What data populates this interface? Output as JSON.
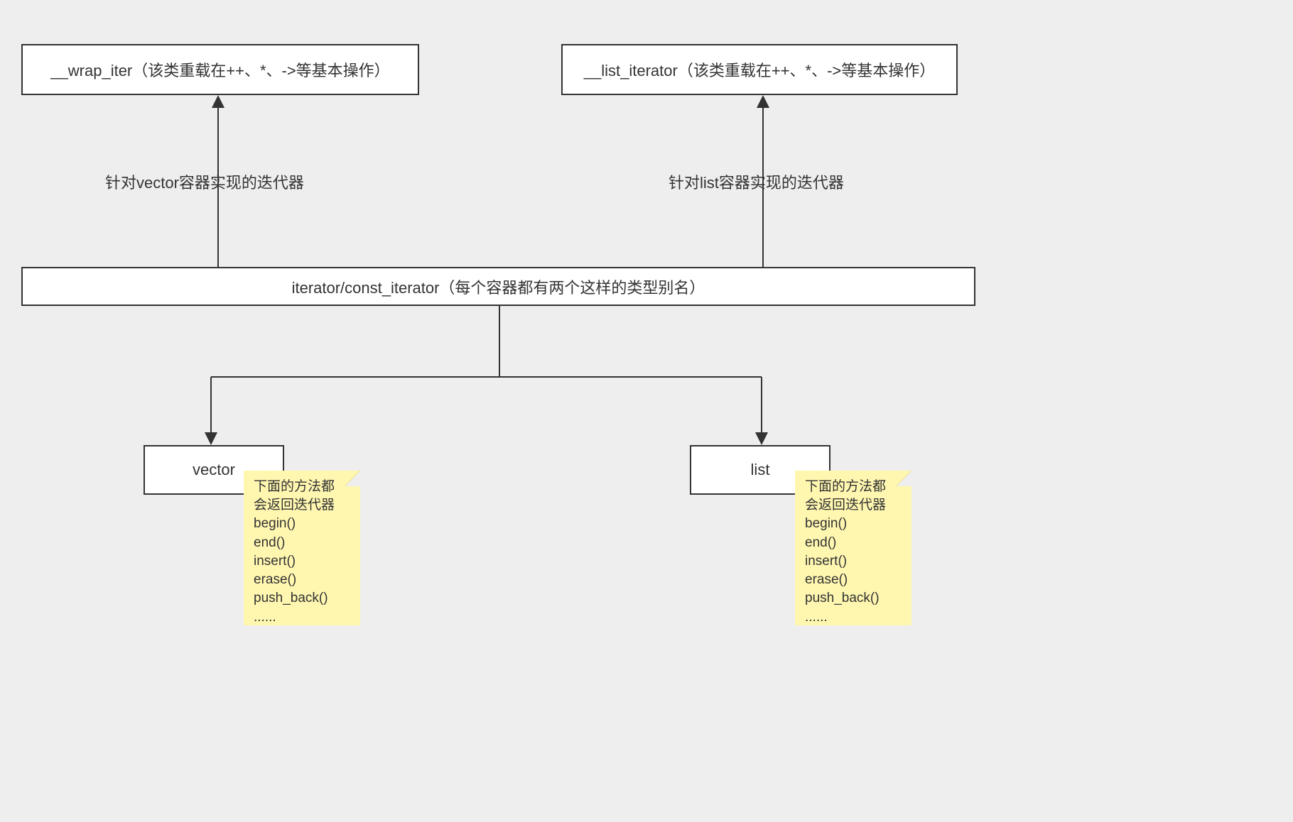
{
  "boxes": {
    "wrap_iter": "__wrap_iter（该类重载在++、*、->等基本操作）",
    "list_iter": "__list_iterator（该类重载在++、*、->等基本操作）",
    "main": "iterator/const_iterator（每个容器都有两个这样的类型别名）",
    "vector": "vector",
    "list": "list"
  },
  "arrow_labels": {
    "vector_impl": "针对vector容器实现的迭代器",
    "list_impl": "针对list容器实现的迭代器"
  },
  "notes": {
    "lines": [
      "下面的方法都",
      "会返回迭代器",
      "begin()",
      "end()",
      "insert()",
      "erase()",
      "push_back()",
      "......"
    ]
  }
}
